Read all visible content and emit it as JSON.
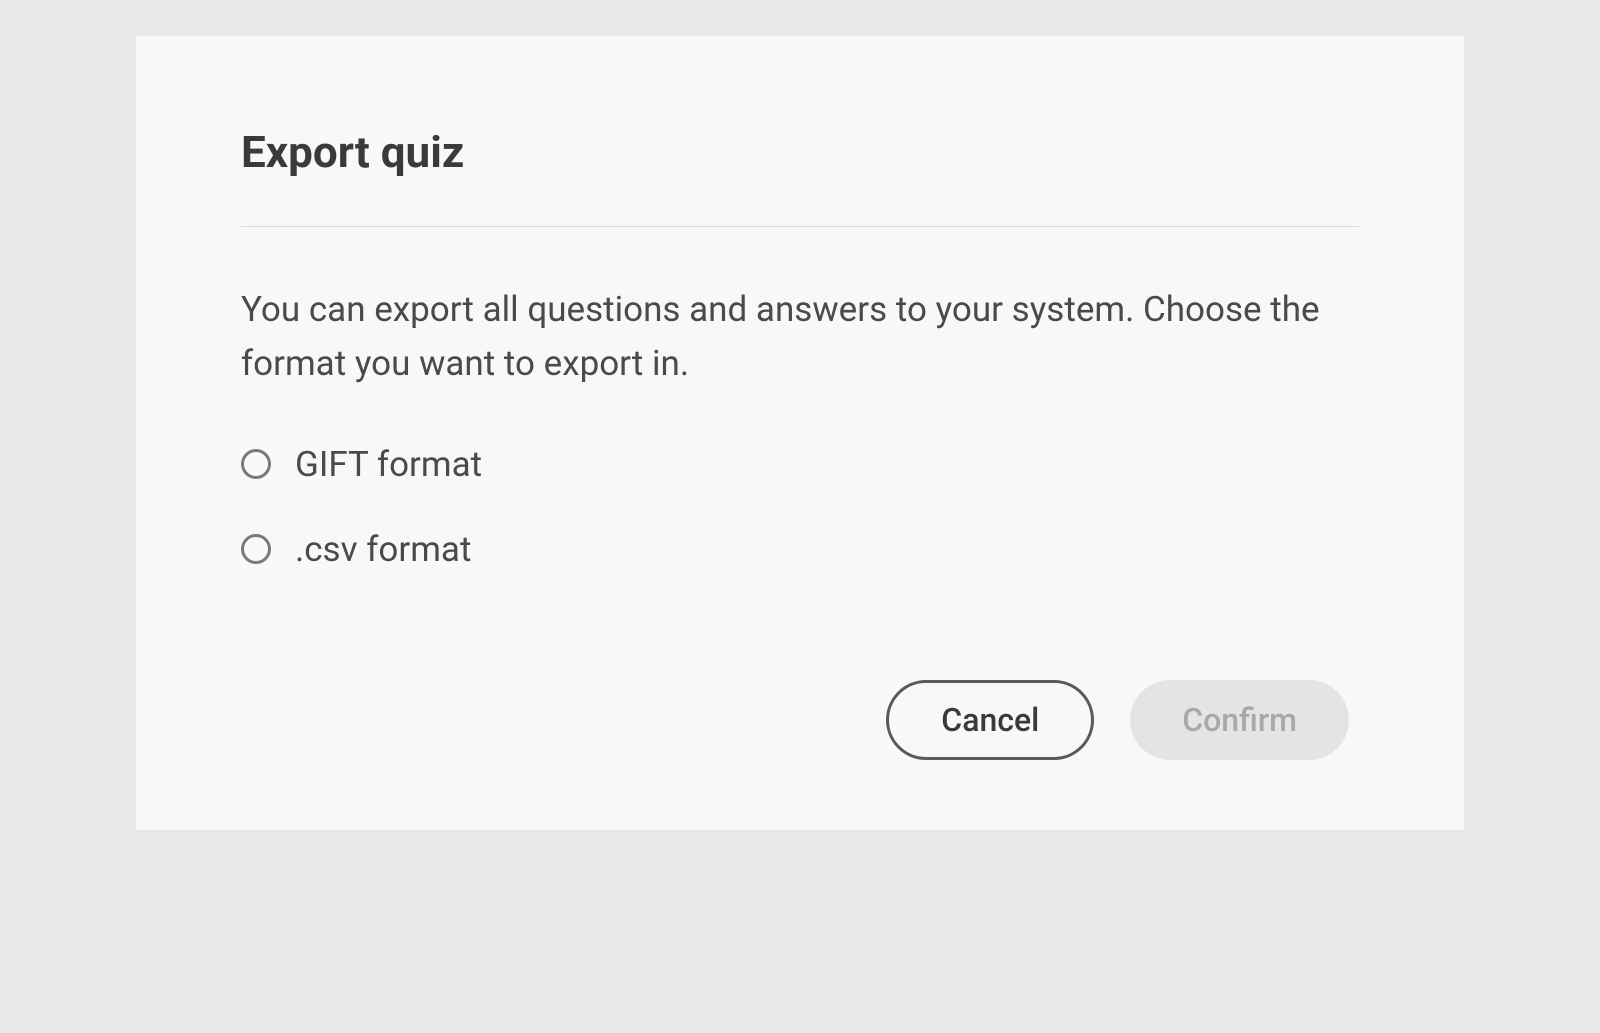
{
  "dialog": {
    "title": "Export quiz",
    "description": "You can export all questions and answers to your system. Choose the format you want to export in.",
    "options": [
      {
        "label": "GIFT format"
      },
      {
        "label": ".csv format"
      }
    ],
    "buttons": {
      "cancel": "Cancel",
      "confirm": "Confirm"
    }
  }
}
